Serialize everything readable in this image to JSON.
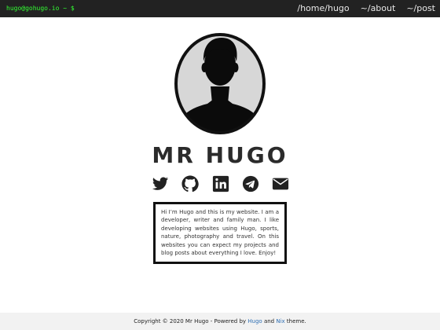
{
  "header": {
    "brand": "hugo@gohugo.io ~ $",
    "nav": [
      {
        "label": "/home/hugo"
      },
      {
        "label": "~/about"
      },
      {
        "label": "~/post"
      }
    ]
  },
  "profile": {
    "name": "MR HUGO",
    "avatar_icon": "person-silhouette-icon"
  },
  "social": [
    {
      "icon": "twitter-icon"
    },
    {
      "icon": "github-icon"
    },
    {
      "icon": "linkedin-icon"
    },
    {
      "icon": "telegram-icon"
    },
    {
      "icon": "email-icon"
    }
  ],
  "bio": {
    "text": "Hi I’m Hugo and this is my website. I am a developer, writer and family man. I like developing websites using Hugo, sports, nature, photography and travel. On this websites you can expect my projects and blog posts about everything I love. Enjoy!"
  },
  "footer": {
    "prefix": "Copyright © 2020 Mr Hugo - Powered by ",
    "hugo_link": "Hugo",
    "and_text": " and ",
    "nix_link": "Nix",
    "suffix": " theme."
  },
  "colors": {
    "header_bg": "#222222",
    "brand": "#33ff33",
    "link": "#2f6fb3"
  }
}
